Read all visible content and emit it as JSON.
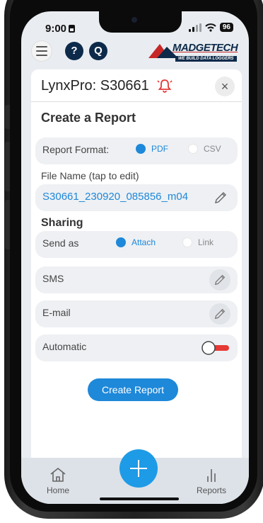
{
  "status_bar": {
    "time": "9:00",
    "battery": "96"
  },
  "top_bar": {
    "help_label": "?",
    "search_label": "Q",
    "logo_name": "MADGETECH",
    "logo_tagline": "WE BUILD DATA LOGGERS"
  },
  "panel": {
    "title": "LynxPro: S30661",
    "close_label": "×"
  },
  "report": {
    "heading": "Create a Report",
    "format_label": "Report Format:",
    "format_options": [
      {
        "label": "PDF",
        "selected": true
      },
      {
        "label": "CSV",
        "selected": false
      }
    ],
    "file_name_label": "File Name (tap to edit)",
    "file_name_value": "S30661_230920_085856_m04"
  },
  "sharing": {
    "heading": "Sharing",
    "send_as_label": "Send as",
    "send_options": [
      {
        "label": "Attach",
        "selected": true
      },
      {
        "label": "Link",
        "selected": false
      }
    ],
    "sms_label": "SMS",
    "email_label": "E-mail",
    "automatic_label": "Automatic",
    "automatic_enabled": false
  },
  "create_button": "Create Report",
  "bottom_nav": {
    "home_label": "Home",
    "reports_label": "Reports"
  },
  "colors": {
    "accent": "#1e88d9",
    "fab": "#1e9be6",
    "alert": "#e53935",
    "brand_navy": "#0d2a4a",
    "brand_red": "#c62828"
  },
  "icons": [
    "menu-icon",
    "help-icon",
    "search-icon",
    "bell-alert-icon",
    "close-icon",
    "pencil-icon",
    "toggle-switch",
    "home-icon",
    "plus-icon",
    "reports-bars-icon"
  ]
}
